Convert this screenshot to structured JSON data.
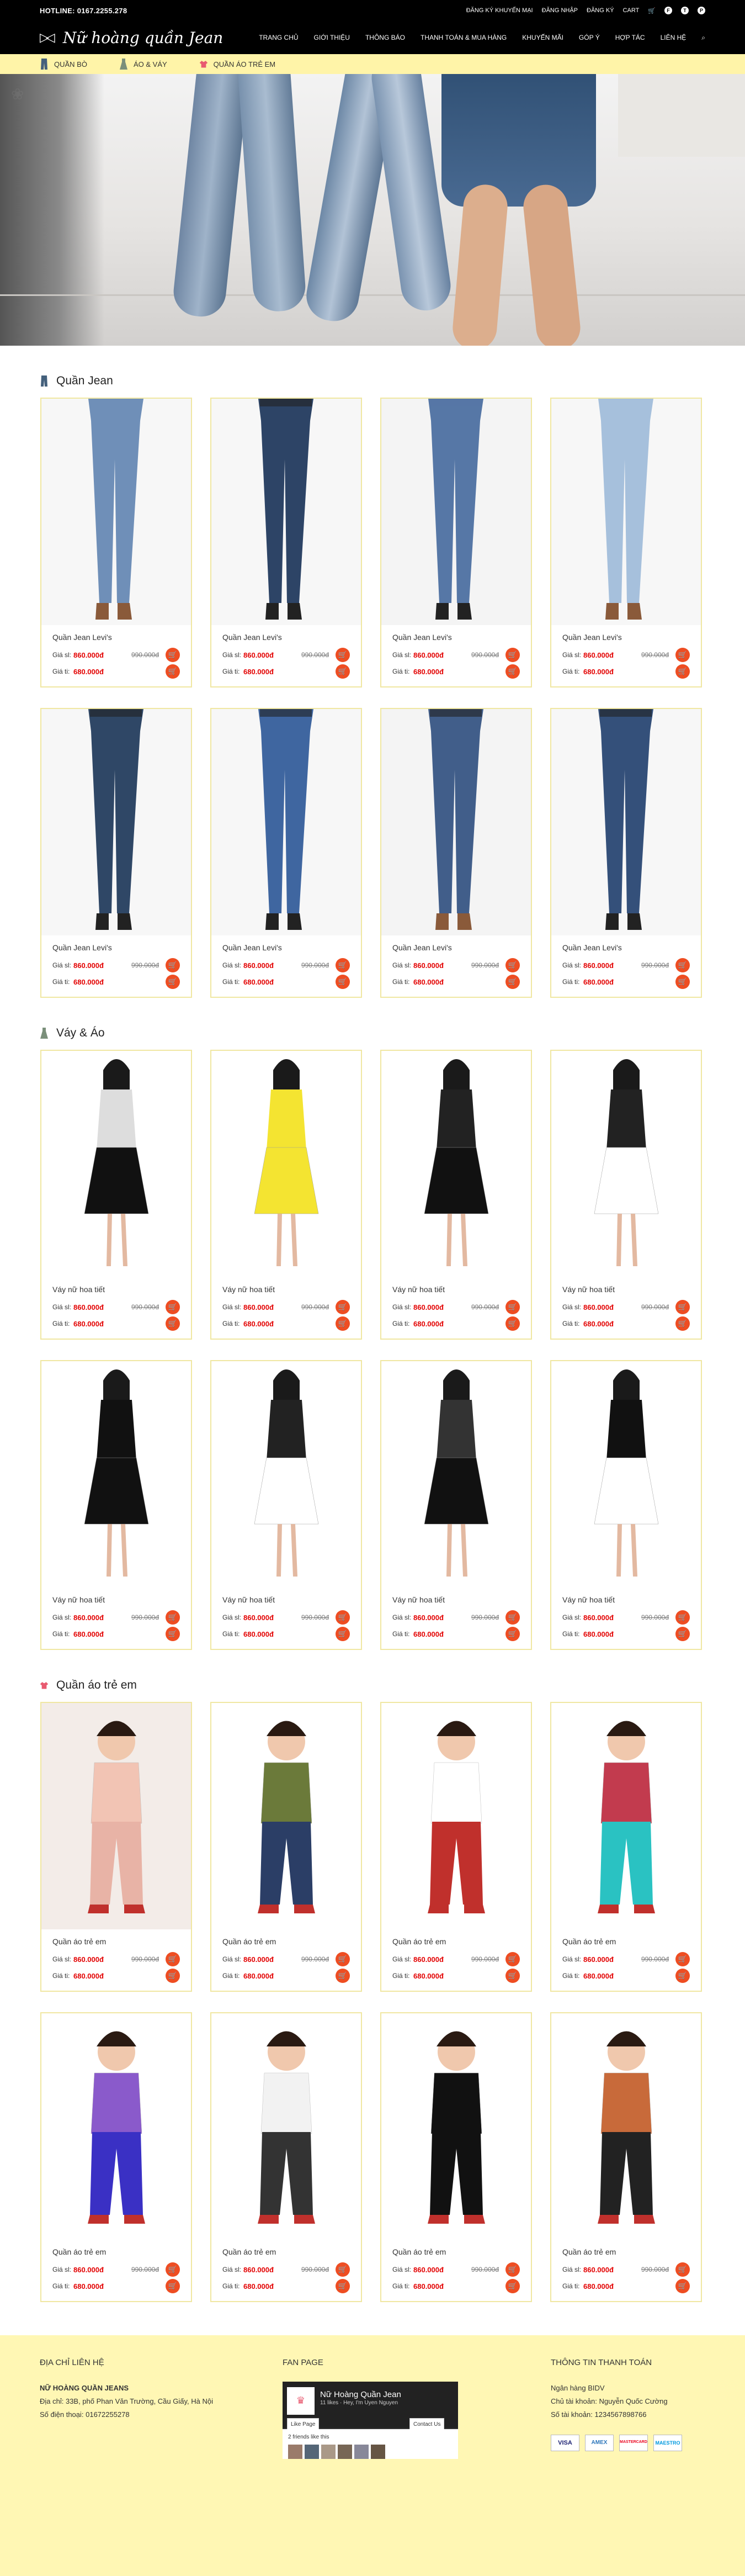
{
  "topbar": {
    "hotline": "HOTLINE: 0167.2255.278",
    "links": [
      "ĐĂNG KÝ KHUYẾN MẠI",
      "ĐĂNG NHẬP",
      "ĐĂNG KÝ",
      "CART"
    ],
    "icons": [
      "cart-icon",
      "facebook-icon",
      "twitter-icon",
      "pinterest-icon"
    ]
  },
  "nav": {
    "logo": "Nữ hoàng quần Jean",
    "menu": [
      "TRANG CHỦ",
      "GIỚI THIỆU",
      "THÔNG BÁO",
      "THANH TOÁN & MUA HÀNG",
      "KHUYẾN MÃI",
      "GÓP Ý",
      "HỢP TÁC",
      "LIÊN HỆ"
    ]
  },
  "subnav": [
    "QUẦN BÒ",
    "ÁO & VÁY",
    "QUẦN ÁO TRẺ EM"
  ],
  "labels": {
    "now": "Giá sl:",
    "before": "Giá ti:"
  },
  "sections": [
    {
      "title": "Quần Jean",
      "icon": "jeans-icon",
      "products": [
        {
          "name": "Quần Jean Levi's",
          "price_now": "860.000đ",
          "price_old": "990.000đ",
          "price_before": "680.000đ"
        },
        {
          "name": "Quần Jean Levi's",
          "price_now": "860.000đ",
          "price_old": "990.000đ",
          "price_before": "680.000đ"
        },
        {
          "name": "Quần Jean Levi's",
          "price_now": "860.000đ",
          "price_old": "990.000đ",
          "price_before": "680.000đ"
        },
        {
          "name": "Quần Jean Levi's",
          "price_now": "860.000đ",
          "price_old": "990.000đ",
          "price_before": "680.000đ"
        },
        {
          "name": "Quần Jean Levi's",
          "price_now": "860.000đ",
          "price_old": "990.000đ",
          "price_before": "680.000đ"
        },
        {
          "name": "Quần Jean Levi's",
          "price_now": "860.000đ",
          "price_old": "990.000đ",
          "price_before": "680.000đ"
        },
        {
          "name": "Quần Jean Levi's",
          "price_now": "860.000đ",
          "price_old": "990.000đ",
          "price_before": "680.000đ"
        },
        {
          "name": "Quần Jean Levi's",
          "price_now": "860.000đ",
          "price_old": "990.000đ",
          "price_before": "680.000đ"
        }
      ]
    },
    {
      "title": "Váy & Áo",
      "icon": "dress-icon",
      "products": [
        {
          "name": "Váy nữ hoa tiết",
          "price_now": "860.000đ",
          "price_old": "990.000đ",
          "price_before": "680.000đ"
        },
        {
          "name": "Váy nữ hoa tiết",
          "price_now": "860.000đ",
          "price_old": "990.000đ",
          "price_before": "680.000đ"
        },
        {
          "name": "Váy nữ hoa tiết",
          "price_now": "860.000đ",
          "price_old": "990.000đ",
          "price_before": "680.000đ"
        },
        {
          "name": "Váy nữ hoa tiết",
          "price_now": "860.000đ",
          "price_old": "990.000đ",
          "price_before": "680.000đ"
        },
        {
          "name": "Váy nữ hoa tiết",
          "price_now": "860.000đ",
          "price_old": "990.000đ",
          "price_before": "680.000đ"
        },
        {
          "name": "Váy nữ hoa tiết",
          "price_now": "860.000đ",
          "price_old": "990.000đ",
          "price_before": "680.000đ"
        },
        {
          "name": "Váy nữ hoa tiết",
          "price_now": "860.000đ",
          "price_old": "990.000đ",
          "price_before": "680.000đ"
        },
        {
          "name": "Váy nữ hoa tiết",
          "price_now": "860.000đ",
          "price_old": "990.000đ",
          "price_before": "680.000đ"
        }
      ]
    },
    {
      "title": "Quần áo trẻ em",
      "icon": "kids-shirt-icon",
      "products": [
        {
          "name": "Quần áo trẻ em",
          "price_now": "860.000đ",
          "price_old": "990.000đ",
          "price_before": "680.000đ"
        },
        {
          "name": "Quần áo trẻ em",
          "price_now": "860.000đ",
          "price_old": "990.000đ",
          "price_before": "680.000đ"
        },
        {
          "name": "Quần áo trẻ em",
          "price_now": "860.000đ",
          "price_old": "990.000đ",
          "price_before": "680.000đ"
        },
        {
          "name": "Quần áo trẻ em",
          "price_now": "860.000đ",
          "price_old": "990.000đ",
          "price_before": "680.000đ"
        },
        {
          "name": "Quần áo trẻ em",
          "price_now": "860.000đ",
          "price_old": "990.000đ",
          "price_before": "680.000đ"
        },
        {
          "name": "Quần áo trẻ em",
          "price_now": "860.000đ",
          "price_old": "990.000đ",
          "price_before": "680.000đ"
        },
        {
          "name": "Quần áo trẻ em",
          "price_now": "860.000đ",
          "price_old": "990.000đ",
          "price_before": "680.000đ"
        },
        {
          "name": "Quần áo trẻ em",
          "price_now": "860.000đ",
          "price_old": "990.000đ",
          "price_before": "680.000đ"
        }
      ]
    }
  ],
  "footer": {
    "contact": {
      "heading": "ĐỊA CHỈ LIÊN HỆ",
      "company": "NỮ HOÀNG QUẦN JEANS",
      "address": "Địa chỉ: 33B, phố Phan Văn Trường, Cầu Giấy, Hà Nội",
      "phone": "Số điện thoại: 01672255278"
    },
    "fanpage": {
      "heading": "FAN PAGE",
      "page_name": "Nữ Hoàng Quần Jean",
      "likes": "11 likes",
      "greeting": "Hey, I'm Uyen Nguyen",
      "like_btn": "Like Page",
      "contact_btn": "Contact Us",
      "friends": "2 friends like this"
    },
    "payment": {
      "heading": "THÔNG TIN THANH TOÁN",
      "bank": "Ngân hàng BIDV",
      "owner": "Chủ tài khoản: Nguyễn Quốc Cường",
      "account": "Số tài khoản: 1234567898766",
      "cards": [
        "VISA",
        "AMEX",
        "MASTERCARD",
        "MAESTRO"
      ]
    }
  },
  "colors": {
    "accent": "#fff4a8",
    "price": "#e30000",
    "cart": "#ee4d22",
    "dark": "#000000",
    "border": "#f0e7a2"
  }
}
